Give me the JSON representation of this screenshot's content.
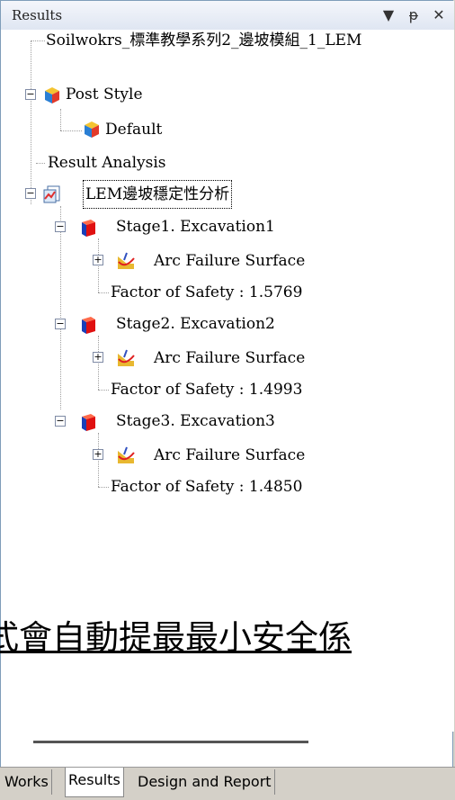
{
  "panel": {
    "title": "Results",
    "buttons": [
      "▼",
      "ᵽ",
      "✕"
    ]
  },
  "tree": {
    "root_label": "Soilwokrs_標準教學系列2_邊坡模組_1_LEM",
    "post_style": "Post Style",
    "default": "Default",
    "result_analysis": "Result Analysis",
    "lem": "LEM邊坡穩定性分析",
    "stages": [
      {
        "label": "Stage1. Excavation1",
        "arc": "Arc Failure Surface",
        "fos": "Factor of Safety : 1.5769"
      },
      {
        "label": "Stage2. Excavation2",
        "arc": "Arc Failure Surface",
        "fos": "Factor of Safety : 1.4993"
      },
      {
        "label": "Stage3. Excavation3",
        "arc": "Arc Failure Surface",
        "fos": "Factor of Safety : 1.4850"
      }
    ]
  },
  "overlay": "式會自動提最最小安全係",
  "tabs": [
    "Works",
    "Results",
    "Design and Report"
  ],
  "colors": {
    "tab_active": "#ffffff",
    "panel_border": "#7f9db9"
  },
  "icons": {
    "post_style": "cube-style-icon",
    "default": "cube-style-icon",
    "lem": "chart-analysis-icon",
    "stage": "red-cube-icon",
    "arc": "arc-failure-icon"
  }
}
